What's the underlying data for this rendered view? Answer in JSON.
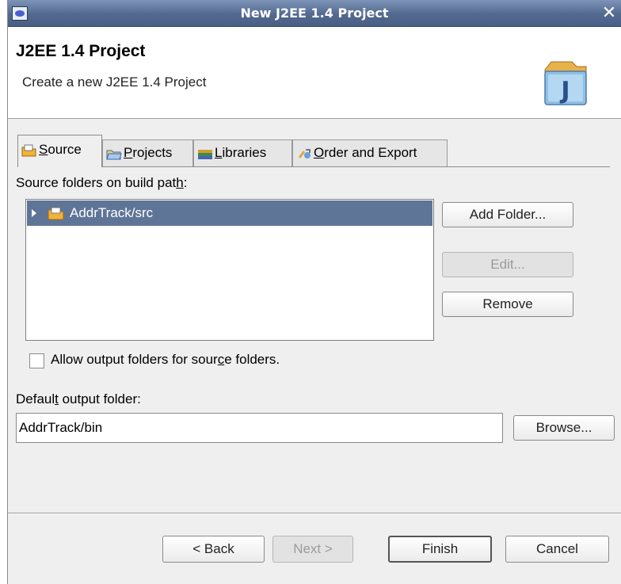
{
  "window": {
    "title": "New J2EE 1.4 Project",
    "close_glyph": "✕"
  },
  "header": {
    "title": "J2EE 1.4 Project",
    "description": "Create a new J2EE 1.4 Project",
    "icon": "java-project-wizard-icon"
  },
  "tabs": [
    {
      "label": "Source",
      "mnemonic": "S",
      "rest": "ource",
      "icon": "source-folder-icon",
      "active": true
    },
    {
      "label": "Projects",
      "mnemonic": "P",
      "rest": "rojects",
      "icon": "projects-folder-icon",
      "active": false
    },
    {
      "label": "Libraries",
      "mnemonic": "L",
      "rest": "ibraries",
      "icon": "libraries-icon",
      "active": false
    },
    {
      "label": "Order and Export",
      "mnemonic": "O",
      "rest": "rder and Export",
      "icon": "order-export-icon",
      "active": false
    }
  ],
  "source_tab": {
    "folders_label_pre": "Source folders on build pat",
    "folders_label_mn": "h",
    "folders_label_post": ":",
    "folders": [
      {
        "name": "AddrTrack/src",
        "selected": true
      }
    ],
    "add_folder": "Add Folder...",
    "edit": "Edit...",
    "remove": "Remove",
    "allow_output_pre": "Allow output folders for sour",
    "allow_output_mn": "c",
    "allow_output_post": "e folders.",
    "allow_output_checked": false
  },
  "output": {
    "label_pre": "Defaul",
    "label_mn": "t",
    "label_post": " output folder:",
    "value": "AddrTrack/bin",
    "browse": "Browse..."
  },
  "footer": {
    "back": "< Back",
    "next": "Next >",
    "finish": "Finish",
    "cancel": "Cancel"
  },
  "colors": {
    "titlebar": "#53698f",
    "selection": "#5f7598",
    "folder_icon": "#f2b23a"
  }
}
